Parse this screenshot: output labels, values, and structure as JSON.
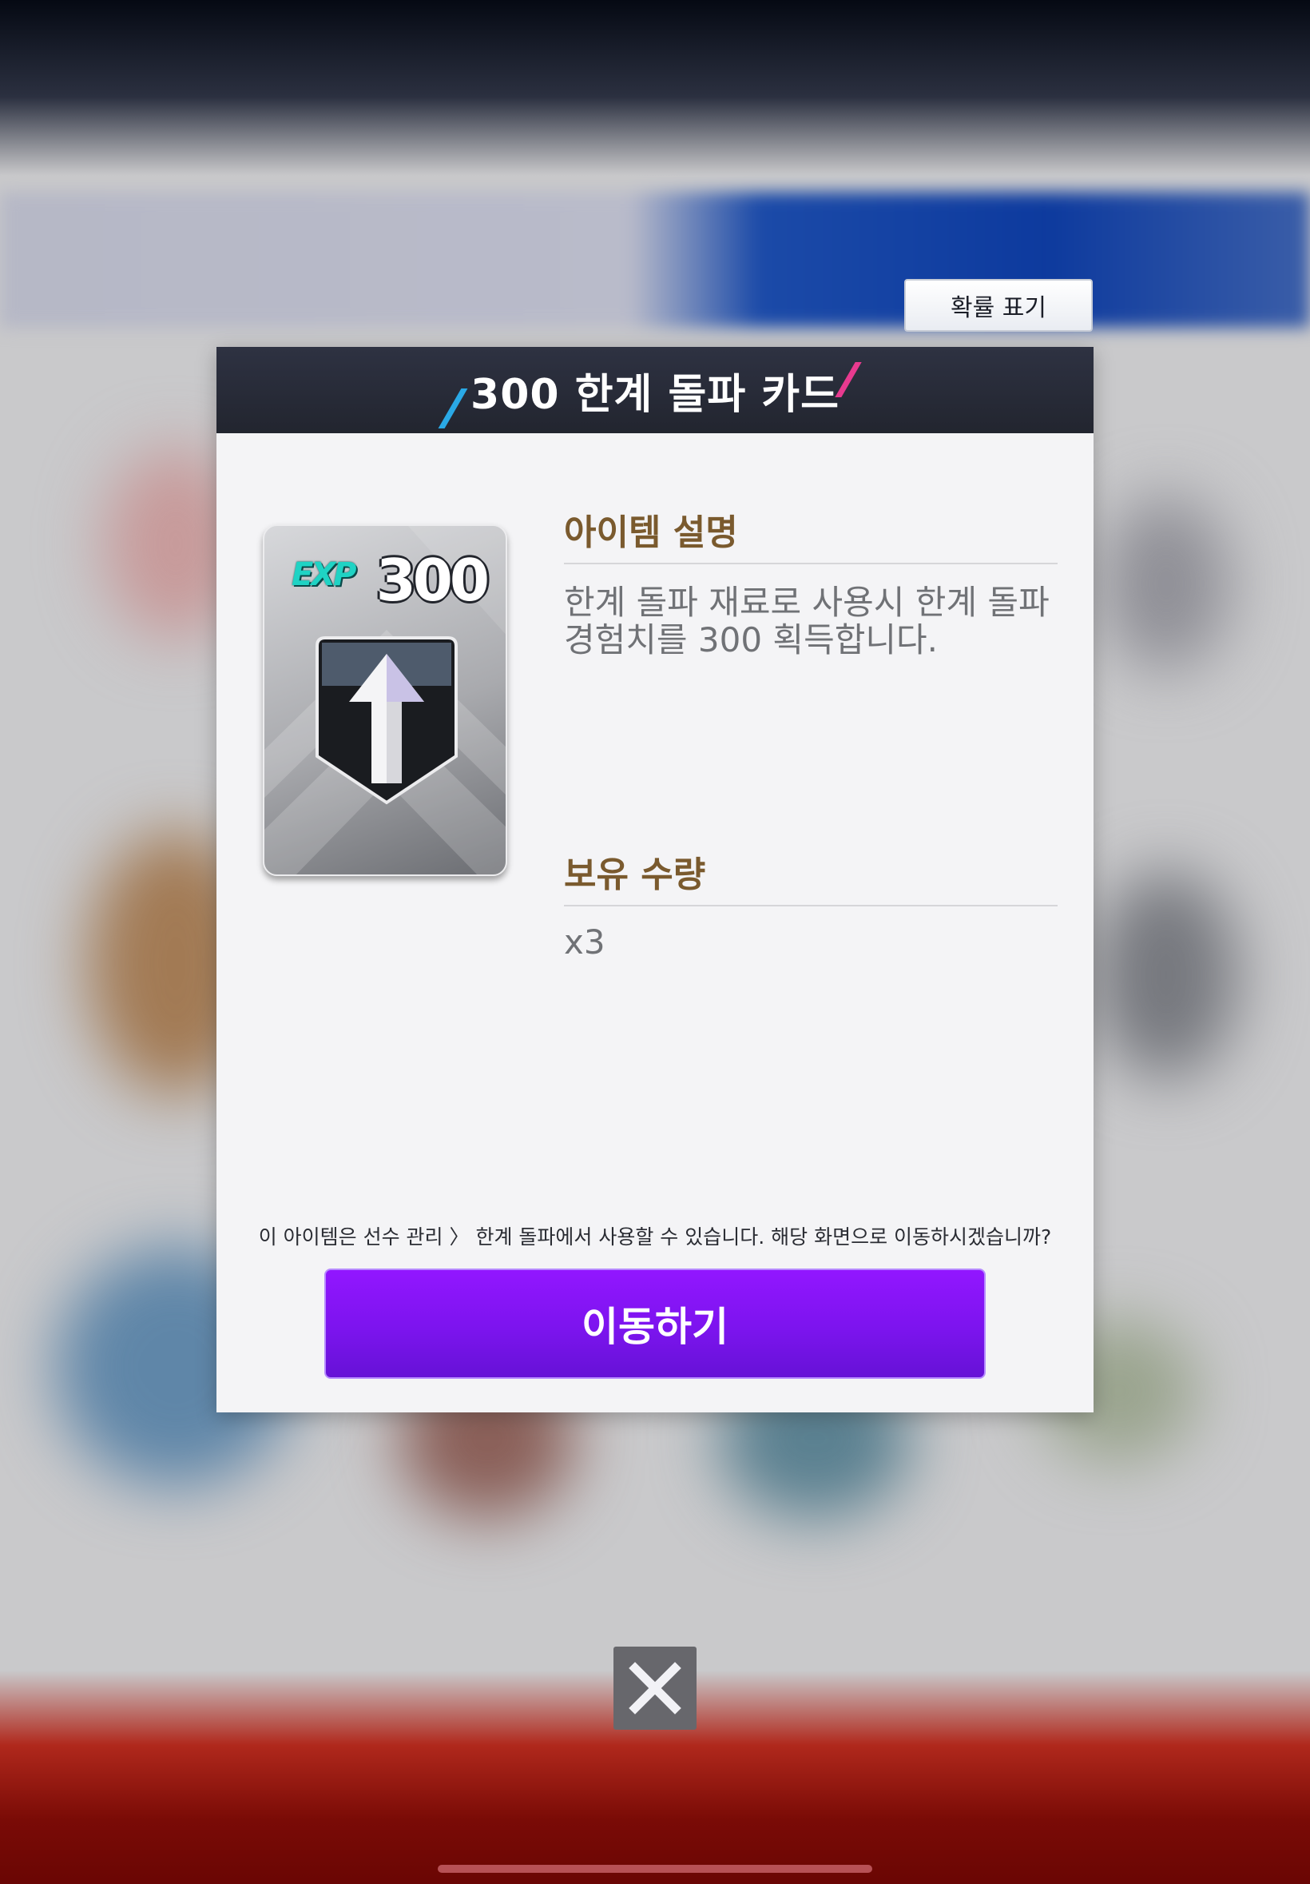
{
  "screen": {
    "probability_button_label": "확률 표기",
    "close_icon": "close-icon"
  },
  "modal": {
    "title": "300 한계 돌파 카드",
    "card": {
      "exp_label": "EXP",
      "value": "300",
      "icon": "arrow-up-shield-icon"
    },
    "description_label": "아이템 설명",
    "description_lines": [
      "한계 돌파 재료로 사용시 한계 돌파",
      "경험치를 300 획득합니다."
    ],
    "quantity_label": "보유 수량",
    "quantity_value": "x3",
    "note": "이 아이템은 선수 관리 〉 한계 돌파에서 사용할 수 있습니다. 해당 화면으로 이동하시겠습니까?",
    "move_button_label": "이동하기"
  },
  "colors": {
    "accent_purple": "#7c14ee",
    "header_dark": "#262a36",
    "label_brown": "#7a5a2e",
    "slash_blue": "#2aa9e6",
    "slash_pink": "#e83a8f"
  }
}
